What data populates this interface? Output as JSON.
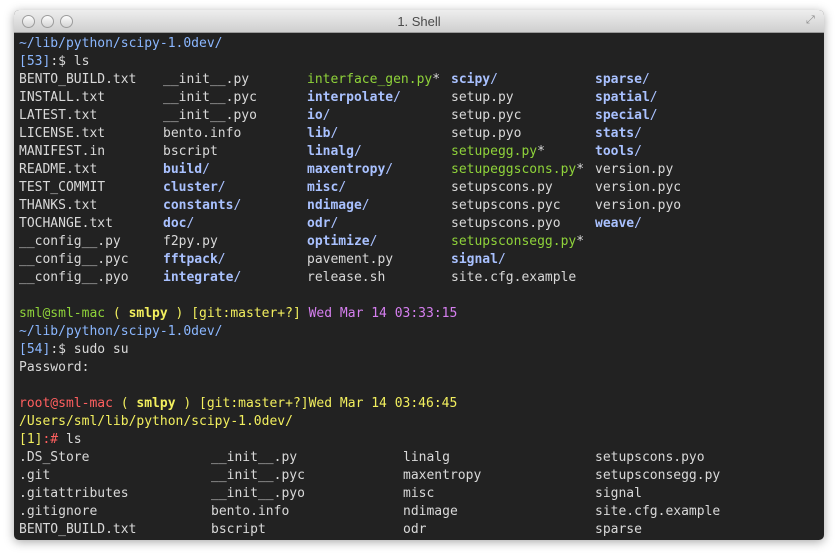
{
  "window": {
    "title": "1. Shell"
  },
  "session1": {
    "cwd": "~/lib/python/scipy-1.0dev/",
    "prompt_num": "[53]",
    "prompt_sep": ":$ ",
    "command": "ls",
    "columns": [
      [
        {
          "n": "BENTO_BUILD.txt",
          "t": "file"
        },
        {
          "n": "INSTALL.txt",
          "t": "file"
        },
        {
          "n": "LATEST.txt",
          "t": "file"
        },
        {
          "n": "LICENSE.txt",
          "t": "file"
        },
        {
          "n": "MANIFEST.in",
          "t": "file"
        },
        {
          "n": "README.txt",
          "t": "file"
        },
        {
          "n": "TEST_COMMIT",
          "t": "file"
        },
        {
          "n": "THANKS.txt",
          "t": "file"
        },
        {
          "n": "TOCHANGE.txt",
          "t": "file"
        },
        {
          "n": "__config__.py",
          "t": "file"
        },
        {
          "n": "__config__.pyc",
          "t": "file"
        },
        {
          "n": "__config__.pyo",
          "t": "file"
        }
      ],
      [
        {
          "n": "__init__.py",
          "t": "file"
        },
        {
          "n": "__init__.pyc",
          "t": "file"
        },
        {
          "n": "__init__.pyo",
          "t": "file"
        },
        {
          "n": "bento.info",
          "t": "file"
        },
        {
          "n": "bscript",
          "t": "file"
        },
        {
          "n": "build",
          "t": "dir"
        },
        {
          "n": "cluster",
          "t": "dir"
        },
        {
          "n": "constants",
          "t": "dir"
        },
        {
          "n": "doc",
          "t": "dir"
        },
        {
          "n": "f2py.py",
          "t": "file"
        },
        {
          "n": "fftpack",
          "t": "dir"
        },
        {
          "n": "integrate",
          "t": "dir"
        }
      ],
      [
        {
          "n": "interface_gen.py",
          "t": "exec"
        },
        {
          "n": "interpolate",
          "t": "dir"
        },
        {
          "n": "io",
          "t": "dir"
        },
        {
          "n": "lib",
          "t": "dir"
        },
        {
          "n": "linalg",
          "t": "dir"
        },
        {
          "n": "maxentropy",
          "t": "dir"
        },
        {
          "n": "misc",
          "t": "dir"
        },
        {
          "n": "ndimage",
          "t": "dir"
        },
        {
          "n": "odr",
          "t": "dir"
        },
        {
          "n": "optimize",
          "t": "dir"
        },
        {
          "n": "pavement.py",
          "t": "file"
        },
        {
          "n": "release.sh",
          "t": "file"
        }
      ],
      [
        {
          "n": "scipy",
          "t": "dir"
        },
        {
          "n": "setup.py",
          "t": "file"
        },
        {
          "n": "setup.pyc",
          "t": "file"
        },
        {
          "n": "setup.pyo",
          "t": "file"
        },
        {
          "n": "setupegg.py",
          "t": "exec"
        },
        {
          "n": "setupeggscons.py",
          "t": "exec"
        },
        {
          "n": "setupscons.py",
          "t": "file"
        },
        {
          "n": "setupscons.pyc",
          "t": "file"
        },
        {
          "n": "setupscons.pyo",
          "t": "file"
        },
        {
          "n": "setupsconsegg.py",
          "t": "exec"
        },
        {
          "n": "signal",
          "t": "dir"
        },
        {
          "n": "site.cfg.example",
          "t": "file"
        }
      ],
      [
        {
          "n": "sparse",
          "t": "dir"
        },
        {
          "n": "spatial",
          "t": "dir"
        },
        {
          "n": "special",
          "t": "dir"
        },
        {
          "n": "stats",
          "t": "dir"
        },
        {
          "n": "tools",
          "t": "dir"
        },
        {
          "n": "version.py",
          "t": "file"
        },
        {
          "n": "version.pyc",
          "t": "file"
        },
        {
          "n": "version.pyo",
          "t": "file"
        },
        {
          "n": "weave",
          "t": "dir"
        }
      ]
    ]
  },
  "status1": {
    "user": "sml@sml-mac",
    "env_open": " ( ",
    "env": "smlpy",
    "env_close": " ) ",
    "git": "[git:master+?]",
    "space": " ",
    "date": "Wed Mar 14 03:33:15"
  },
  "session2": {
    "cwd": "~/lib/python/scipy-1.0dev/",
    "prompt_num": "[54]",
    "prompt_sep": ":$ ",
    "command": "sudo su",
    "password_label": "Password:"
  },
  "status2": {
    "user": "root@sml-mac",
    "env_open": " ( ",
    "env": "smlpy",
    "env_close": " ) ",
    "git": "[git:master+?]",
    "date": "Wed Mar 14 03:46:45"
  },
  "session3": {
    "cwd": "/Users/sml/lib/python/scipy-1.0dev/",
    "prompt_num": "[1]",
    "prompt_sep": ":# ",
    "command": "ls",
    "columns": [
      [
        ".DS_Store",
        ".git",
        ".gitattributes",
        ".gitignore",
        "BENTO_BUILD.txt"
      ],
      [
        "__init__.py",
        "__init__.pyc",
        "__init__.pyo",
        "bento.info",
        "bscript"
      ],
      [
        "linalg",
        "maxentropy",
        "misc",
        "ndimage",
        "odr"
      ],
      [
        "setupscons.pyo",
        "setupsconsegg.py",
        "signal",
        "site.cfg.example",
        "sparse"
      ]
    ]
  },
  "colors": {
    "background": "#222222",
    "directory": "#a9c1ff",
    "executable": "#8fd33a",
    "path": "#8bb7ff",
    "user": "#8fd33a",
    "root_user": "#ff5f5f",
    "env": "#f2ef5e",
    "date": "#d67ff0"
  }
}
